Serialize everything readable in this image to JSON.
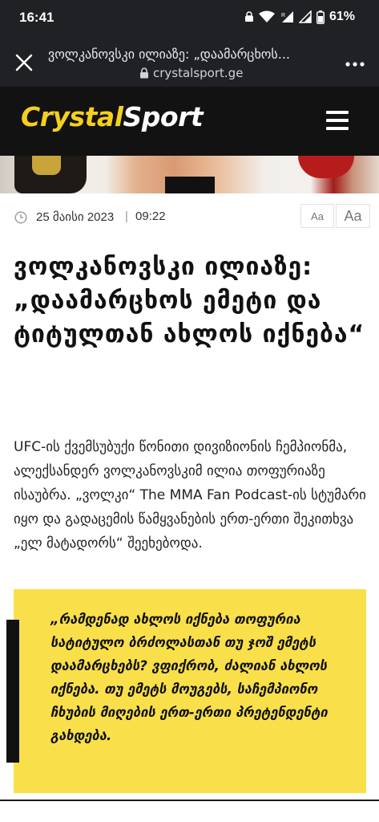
{
  "status_bar": {
    "time": "16:41",
    "battery_percent": "61%",
    "icons": [
      "lock-key-icon",
      "wifi-icon",
      "signal-r-icon",
      "signal-icon",
      "battery-icon"
    ]
  },
  "browser": {
    "page_title": "ვოლკანოვსკი ილიაზე: „დაამარცხოს...",
    "url": "crystalsport.ge",
    "icons": [
      "close-icon",
      "lock-icon",
      "more-vert-icon"
    ]
  },
  "site": {
    "logo_part1": "Crystal",
    "logo_part2": "Sport",
    "brand_color": "#f5cf1e",
    "header_bg": "#121212",
    "menu_icon": "hamburger-menu-icon"
  },
  "article": {
    "date": "25 მაისი 2023",
    "separator": "|",
    "time": "09:22",
    "font_small_label": "Aa",
    "font_large_label": "Aa",
    "headline": "ვოლკანოვსკი ილიაზე: „დაამარცხოს ემეტი და ტიტულთან ახლოს იქნება“",
    "lead": "UFC-ის ქვემსუბუქი წონითი დივიზიონის ჩემპიონმა, ალექსანდერ ვოლკანოვსკიმ ილია თოფურიაზე ისაუბრა. „ვოლკი“ The MMA Fan Podcast-ის სტუმარი იყო და გადაცემის წამყვანების ერთ-ერთი შეკითხვა „ელ მატადორს“ შეეხებოდა.",
    "quote": "„რამდენად ახლოს იქნება თოფურია სატიტულო ბრძოლასთან თუ ჯოშ ემეტს დაამარცხებს? ვფიქრობ, ძალიან ახლოს იქნება. თუ ემეტს მოუგებს, საჩემპიონო ჩხუბის მიღების ერთ-ერთი პრეტენდენტი გახდება.",
    "quote_bg": "#f9e04b"
  }
}
